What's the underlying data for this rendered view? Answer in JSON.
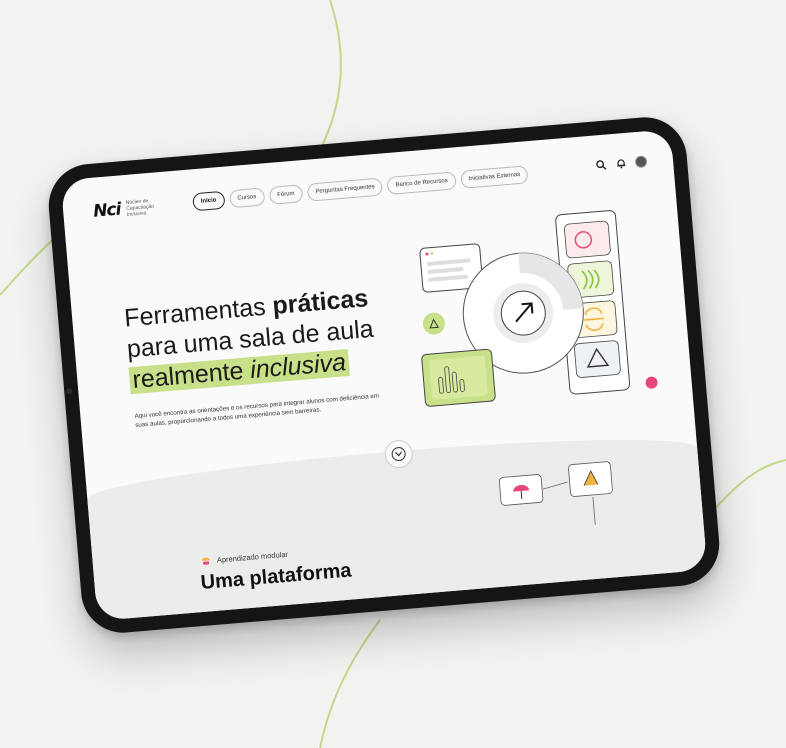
{
  "colors": {
    "background": "#f2f2f0",
    "accent_green": "#c9e08a",
    "accent_pink": "#e8457a",
    "tablet_frame": "#151515",
    "decor_line": "#c3d98a"
  },
  "logo": {
    "mark": "Nci",
    "subtitle": "Núcleo de Capacitação Inclusiva"
  },
  "nav": {
    "items": [
      "Início",
      "Cursos",
      "Fórum",
      "Perguntas Frequentes",
      "Banco de Recursos",
      "Iniciativas Externas"
    ],
    "active": "Início"
  },
  "header_icons": [
    "search-icon",
    "bell-icon",
    "avatar"
  ],
  "hero": {
    "title_line1_normal": "Ferramentas ",
    "title_line1_bold": "práticas",
    "title_line2": "para uma sala de aula",
    "title_line3_normal": "realmente ",
    "title_line3_italic": "inclusiva",
    "description": "Aqui você encontra as orientações e os recursos para integrar alunos com deficiência em suas aulas, proporcionando a todos uma experiência sem barreiras."
  },
  "section": {
    "tag": "Aprendizado modular",
    "title": "Uma plataforma"
  }
}
